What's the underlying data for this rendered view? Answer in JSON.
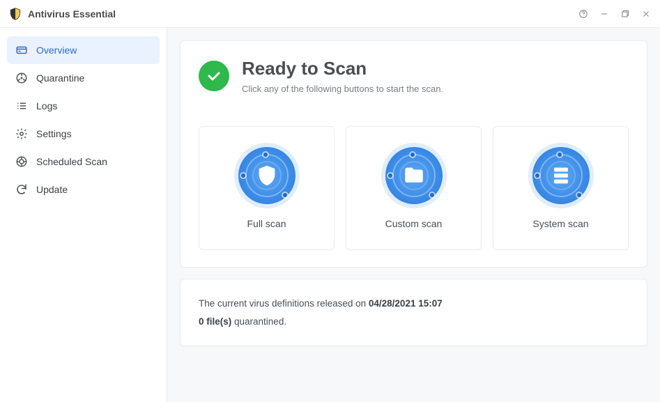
{
  "app": {
    "title": "Antivirus Essential"
  },
  "window_controls": {
    "help": "help-icon",
    "minimize": "minimize-icon",
    "maximize": "restore-icon",
    "close": "close-icon"
  },
  "sidebar": {
    "active_index": 0,
    "items": [
      {
        "icon": "overview-icon",
        "label": "Overview"
      },
      {
        "icon": "quarantine-icon",
        "label": "Quarantine"
      },
      {
        "icon": "logs-icon",
        "label": "Logs"
      },
      {
        "icon": "settings-icon",
        "label": "Settings"
      },
      {
        "icon": "scheduled-icon",
        "label": "Scheduled Scan"
      },
      {
        "icon": "update-icon",
        "label": "Update"
      }
    ]
  },
  "status": {
    "state": "ready",
    "status_color": "#2fb84b",
    "title": "Ready to Scan",
    "subtitle": "Click any of the following buttons to start the scan."
  },
  "scans": [
    {
      "id": "full",
      "icon": "shield-icon",
      "label": "Full scan"
    },
    {
      "id": "custom",
      "icon": "folder-icon",
      "label": "Custom scan"
    },
    {
      "id": "system",
      "icon": "server-icon",
      "label": "System scan"
    }
  ],
  "info": {
    "definitions_prefix": "The current virus definitions released on ",
    "definitions_date": "04/28/2021 15:07",
    "quarantine_count": "0 file(s)",
    "quarantine_suffix": " quarantined."
  }
}
